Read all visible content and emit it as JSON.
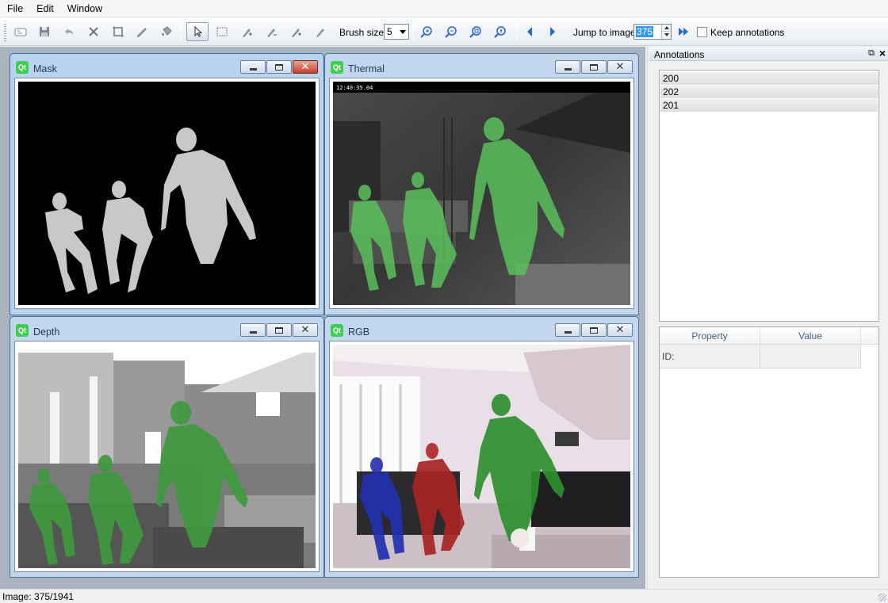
{
  "menu": {
    "items": [
      "File",
      "Edit",
      "Window"
    ]
  },
  "toolbar": {
    "icons": [
      "wand-icon",
      "save-icon",
      "undo-icon",
      "cut-icon",
      "crop-icon",
      "brush-icon",
      "fill-icon",
      "pointer-icon",
      "rect-select-icon",
      "pen-add-icon",
      "pen-remove-icon",
      "pen-add2-icon",
      "pen-icon",
      "zoom-in-icon",
      "zoom-out-icon",
      "zoom-fit-icon",
      "zoom-original-icon",
      "prev-icon",
      "next-icon",
      "last-icon"
    ],
    "brush_label": "Brush size:",
    "brush_value": "5",
    "jump_label": "Jump to image:",
    "jump_value": "375",
    "keep_label": "Keep annotations"
  },
  "windows": {
    "mask": {
      "title": "Mask"
    },
    "thermal": {
      "title": "Thermal",
      "timestamp": "12:40:35.04"
    },
    "depth": {
      "title": "Depth"
    },
    "rgb": {
      "title": "RGB"
    }
  },
  "dock": {
    "title": "Annotations",
    "annotations": [
      "200",
      "202",
      "201"
    ],
    "table_headers": [
      "Property",
      "Value"
    ],
    "table_rows": [
      {
        "property": "ID:",
        "value": ""
      }
    ]
  },
  "status": {
    "text": "Image: 375/1941"
  },
  "colors": {
    "accent": "#3399ff",
    "annotation_overlay": "#3c9e3c",
    "subwindow_active": "#b9d3ee"
  }
}
